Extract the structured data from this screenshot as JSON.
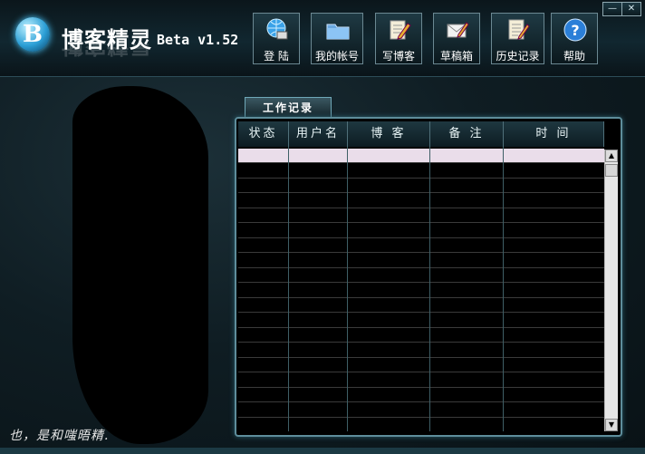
{
  "app": {
    "name": "博客精灵",
    "version": "Beta v1.52",
    "logo_letter": "B"
  },
  "window_controls": {
    "minimize": "—",
    "close": "✕"
  },
  "toolbar": [
    {
      "label": "登 陆",
      "icon": "globe-computer-icon"
    },
    {
      "label": "我的帐号",
      "icon": "folder-icon"
    },
    {
      "label": "写博客",
      "icon": "notepad-pencil-icon"
    },
    {
      "label": "草稿箱",
      "icon": "envelope-pencil-icon"
    },
    {
      "label": "历史记录",
      "icon": "notebook-pencil-icon"
    },
    {
      "label": "帮助",
      "icon": "help-icon"
    }
  ],
  "tab": {
    "label": "工作记录"
  },
  "table": {
    "columns": [
      "状态",
      "用户名",
      "博 客",
      "备 注",
      "时 间"
    ],
    "rows": []
  },
  "status_text": "也，是和嗤晤精.",
  "colors": {
    "selected_row": "#eaddea",
    "accent": "#5e8d9b"
  }
}
